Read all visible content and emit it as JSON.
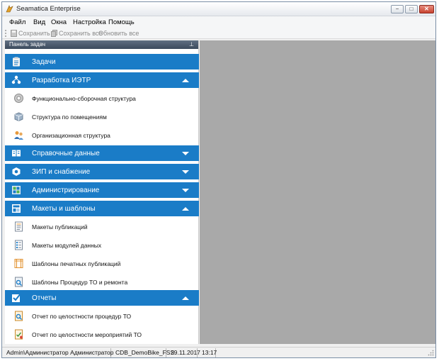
{
  "window": {
    "title": "Seamatica Enterprise",
    "controls": {
      "minimize": "−",
      "maximize": "□",
      "close": "✕"
    }
  },
  "menu": [
    "Файл",
    "Вид",
    "Окна",
    "Настройка",
    "Помощь"
  ],
  "toolbar": {
    "save": "Сохранить",
    "save_all": "Сохранить все",
    "refresh_all": "Обновить все"
  },
  "panel": {
    "title": "Панель задач",
    "sections": [
      {
        "label": "Задачи",
        "icon": "clipboard-icon",
        "state": "collapsed",
        "items": []
      },
      {
        "label": "Разработка ИЭТР",
        "icon": "network-icon",
        "state": "expanded",
        "items": [
          {
            "label": "Функционально-сборочная структура",
            "icon": "gear-icon"
          },
          {
            "label": "Структура по помещениям",
            "icon": "cube-icon"
          },
          {
            "label": "Организационная структура",
            "icon": "people-icon"
          }
        ]
      },
      {
        "label": "Справочные данные",
        "icon": "book-icon",
        "state": "collapsed",
        "items": []
      },
      {
        "label": "ЗИП и снабжение",
        "icon": "nut-icon",
        "state": "collapsed",
        "items": []
      },
      {
        "label": "Администрирование",
        "icon": "admin-grid-icon",
        "state": "collapsed",
        "items": []
      },
      {
        "label": "Макеты и шаблоны",
        "icon": "layout-icon",
        "state": "expanded",
        "items": [
          {
            "label": "Макеты публикаций",
            "icon": "document-lines-icon"
          },
          {
            "label": "Макеты модулей данных",
            "icon": "document-list-icon"
          },
          {
            "label": "Шаблоны печатных публикаций",
            "icon": "print-template-icon"
          },
          {
            "label": "Шаблоны Процедур ТО и ремонта",
            "icon": "procedure-search-icon"
          }
        ]
      },
      {
        "label": "Отчеты",
        "icon": "checkbox-icon",
        "state": "expanded",
        "items": [
          {
            "label": "Отчет по целостности процедур ТО",
            "icon": "report-search-icon"
          },
          {
            "label": "Отчет по целостности мероприятий ТО",
            "icon": "report-check-icon"
          }
        ]
      }
    ]
  },
  "status": {
    "user": "Admin\\Администратор Администратор",
    "database": "CDB_DemoBike_FSS",
    "date": "29.11.2017",
    "time": "13:17"
  },
  "colors": {
    "section_bg": "#1a7cc7",
    "workspace_bg": "#a9a9a9",
    "panel_head": "#3b4a5c"
  }
}
